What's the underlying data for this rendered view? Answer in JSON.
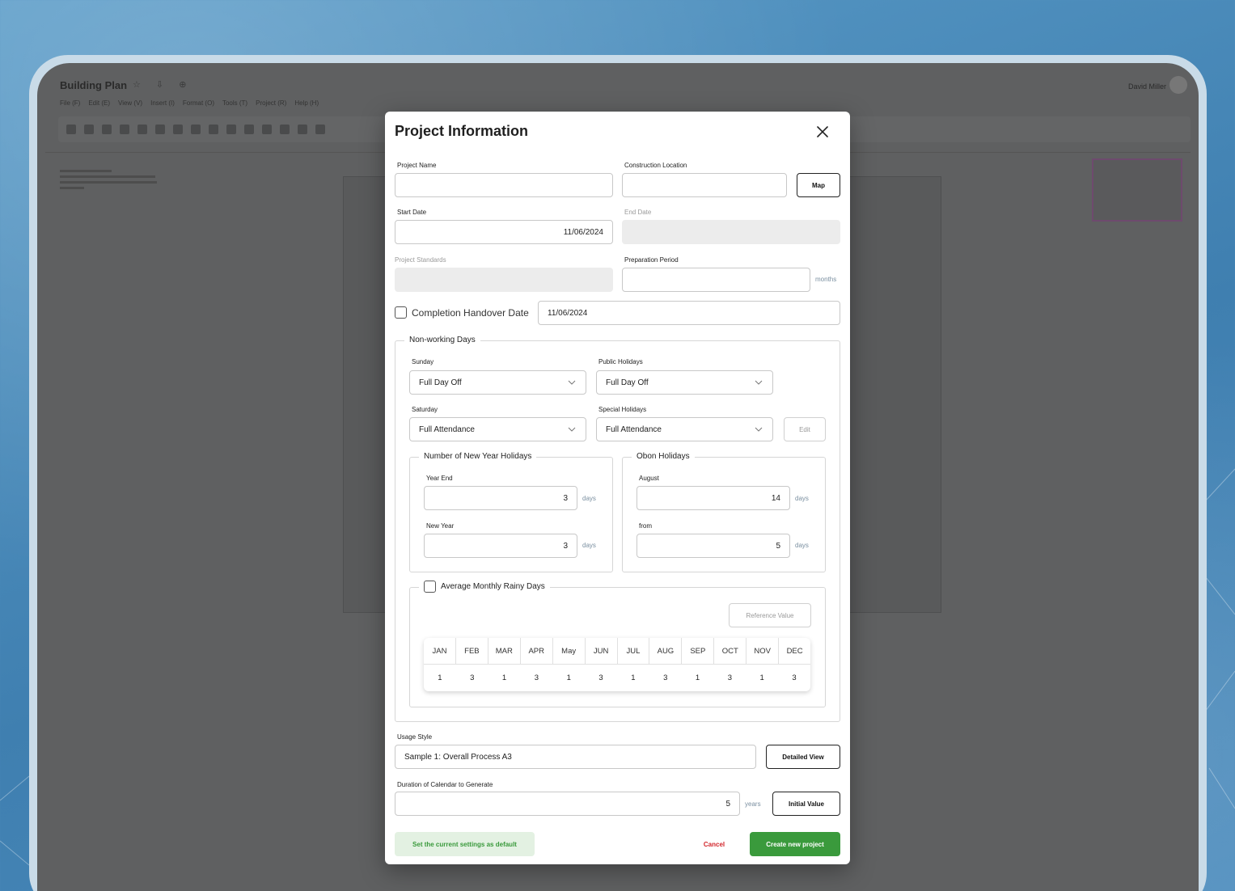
{
  "app": {
    "title": "Building Plan",
    "menu": [
      "File (F)",
      "Edit (E)",
      "View (V)",
      "Insert (I)",
      "Format (O)",
      "Tools (T)",
      "Project (R)",
      "Help (H)"
    ],
    "user_name": "David Miller"
  },
  "modal": {
    "title": "Project Information",
    "project_name": {
      "label": "Project Name",
      "value": ""
    },
    "construction_location": {
      "label": "Construction Location",
      "value": "",
      "map_button": "Map"
    },
    "start_date": {
      "label": "Start Date",
      "value": "11/06/2024"
    },
    "end_date": {
      "label": "End Date",
      "value": ""
    },
    "project_standards": {
      "label": "Project Standards",
      "value": ""
    },
    "preparation_period": {
      "label": "Preparation Period",
      "value": "",
      "unit": "months"
    },
    "completion_handover": {
      "label": "Completion Handover Date",
      "checked": false,
      "value": "11/06/2024"
    },
    "non_working": {
      "legend": "Non-working Days",
      "sunday": {
        "label": "Sunday",
        "value": "Full Day Off"
      },
      "public_holidays": {
        "label": "Public Holidays",
        "value": "Full Day Off"
      },
      "saturday": {
        "label": "Saturday",
        "value": "Full Attendance"
      },
      "special_holidays": {
        "label": "Special Holidays",
        "value": "Full Attendance"
      },
      "edit_button": "Edit",
      "new_year": {
        "legend": "Number of New Year Holidays",
        "year_end": {
          "label": "Year End",
          "value": "3",
          "unit": "days"
        },
        "new_year": {
          "label": "New Year",
          "value": "3",
          "unit": "days"
        }
      },
      "obon": {
        "legend": "Obon Holidays",
        "august": {
          "label": "August",
          "value": "14",
          "unit": "days"
        },
        "from": {
          "label": "from",
          "value": "5",
          "unit": "days"
        }
      },
      "rainy": {
        "legend": "Average Monthly Rainy Days",
        "checked": false,
        "reference_button": "Reference Value",
        "months": [
          "JAN",
          "FEB",
          "MAR",
          "APR",
          "May",
          "JUN",
          "JUL",
          "AUG",
          "SEP",
          "OCT",
          "NOV",
          "DEC"
        ],
        "values": [
          "1",
          "3",
          "1",
          "3",
          "1",
          "3",
          "1",
          "3",
          "1",
          "3",
          "1",
          "3"
        ]
      }
    },
    "usage_style": {
      "label": "Usage Style",
      "value": "Sample 1: Overall Process A3",
      "detail_button": "Detailed View"
    },
    "calendar_duration": {
      "label": "Duration of Calendar to Generate",
      "value": "5",
      "unit": "years",
      "initial_button": "Initial Value"
    },
    "footer": {
      "default_button": "Set the current settings as default",
      "cancel_button": "Cancel",
      "create_button": "Create new project"
    }
  },
  "colors": {
    "primary_green": "#3a9a3c",
    "cancel_red": "#d2262b",
    "background_blue": "#4a8ab8"
  }
}
